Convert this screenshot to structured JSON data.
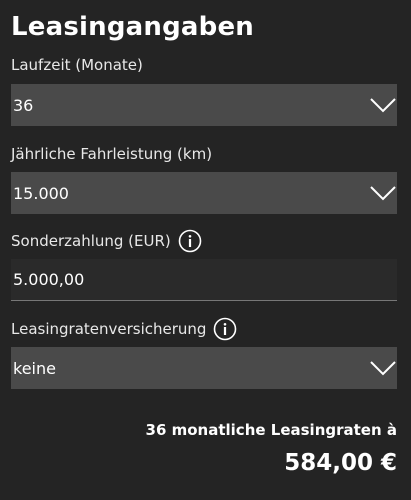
{
  "header": {
    "title": "Leasingangaben"
  },
  "fields": {
    "laufzeit": {
      "label": "Laufzeit (Monate)",
      "value": "36",
      "icon": "chevron-down-icon"
    },
    "fahrleistung": {
      "label": "Jährliche Fahrleistung (km)",
      "value": "15.000",
      "icon": "chevron-down-icon"
    },
    "sonderzahlung": {
      "label": "Sonderzahlung (EUR)",
      "value": "5.000,00",
      "info_icon": "info-icon"
    },
    "versicherung": {
      "label": "Leasingratenversicherung",
      "value": "keine",
      "info_icon": "info-icon",
      "icon": "chevron-down-icon"
    }
  },
  "summary": {
    "label": "36 monatliche Leasingraten à",
    "price": "584,00 €"
  },
  "colors": {
    "background": "#242424",
    "select_background": "#4a4a4a",
    "text": "#ffffff"
  }
}
